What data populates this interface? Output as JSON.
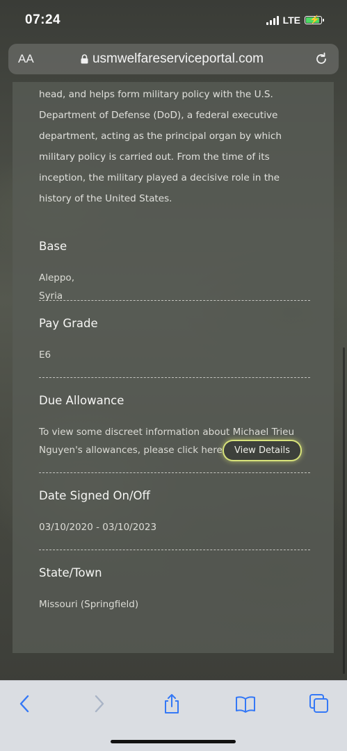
{
  "status_bar": {
    "time": "07:24",
    "network": "LTE"
  },
  "browser": {
    "text_size_label": "AA",
    "url": "usmwelfareserviceportal.com",
    "icons": [
      "lock-icon",
      "reload-icon",
      "back-icon",
      "forward-icon",
      "share-icon",
      "bookmarks-icon",
      "tabs-icon"
    ]
  },
  "page": {
    "intro_text": "head, and helps form military policy with the U.S. Department of Defense (DoD), a federal executive department, acting as the principal organ by which military policy is carried out. From the time of its inception, the military played a decisive role in the history of the United States.",
    "sections": [
      {
        "title": "Base",
        "value": "Aleppo, Syria"
      },
      {
        "title": "Pay Grade",
        "value": "E6"
      },
      {
        "title": "Due Allowance",
        "value": "To view some discreet information about Michael Trieu Nguyen's allowances, please click here"
      },
      {
        "title": "Date Signed On/Off",
        "value": "03/10/2020 - 03/10/2023"
      },
      {
        "title": "State/Town",
        "value": "Missouri (Springfield)"
      }
    ],
    "view_details_label": "View Details"
  },
  "colors": {
    "accent": "#3478f6",
    "button_glow": "#d7e27a",
    "battery": "#4cd964"
  }
}
